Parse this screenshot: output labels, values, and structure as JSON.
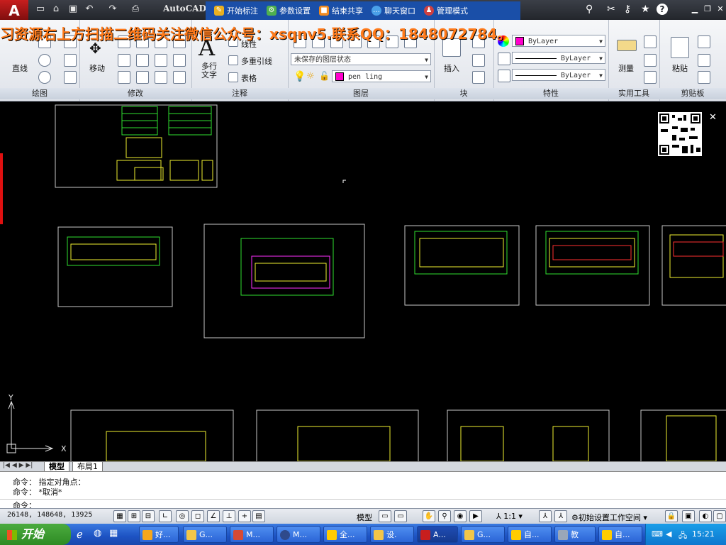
{
  "app": {
    "logo": "A",
    "title": "AutoCAD"
  },
  "plugin_bar": {
    "items": [
      {
        "label": "开始标注",
        "icon": "pen-icon",
        "color": "#e8b020"
      },
      {
        "label": "参数设置",
        "icon": "settings-icon",
        "color": "#4fb04f"
      },
      {
        "label": "结束共享",
        "icon": "share-icon",
        "color": "#f08a20"
      },
      {
        "label": "聊天窗口",
        "icon": "chat-icon",
        "color": "#4aa0e8"
      },
      {
        "label": "管理模式",
        "icon": "admin-icon",
        "color": "#d04040"
      }
    ]
  },
  "watermark": "习资源右上方扫描二维码关注微信公众号：xsqnv5.联系QQ：1848072784。",
  "ribbon": {
    "draw": {
      "title": "绘图",
      "line": "直线"
    },
    "modify": {
      "title": "修改",
      "move": "移动"
    },
    "annotation": {
      "title": "注释",
      "text": "多行\n文字",
      "linear": "线性",
      "mleader": "多重引线",
      "table": "表格"
    },
    "layers": {
      "title": "图层",
      "state": "未保存的图层状态",
      "current": "pen ling"
    },
    "block": {
      "title": "块",
      "insert": "插入"
    },
    "properties": {
      "title": "特性",
      "color": "ByLayer",
      "linetype": "ByLayer",
      "lineweight": "ByLayer"
    },
    "utilities": {
      "title": "实用工具",
      "measure": "测量"
    },
    "clipboard": {
      "title": "剪贴板",
      "paste": "粘贴"
    }
  },
  "layout_tabs": [
    "模型",
    "布局1"
  ],
  "command": {
    "lines": [
      "命令：  指定对角点：",
      "命令：  *取消*"
    ],
    "prompt": "命令："
  },
  "status": {
    "coords": "26148,  148648,  13925",
    "model": "模型",
    "scale": "1:1",
    "workspace": "初始设置工作空间"
  },
  "taskbar": {
    "start": "开始",
    "tasks": [
      "好...",
      "G...",
      "M...",
      "M...",
      "全...",
      "设.",
      "A...",
      "G...",
      "自...",
      "教",
      "自..."
    ],
    "time": "15:21"
  },
  "ucs": {
    "x": "X",
    "y": "Y"
  }
}
